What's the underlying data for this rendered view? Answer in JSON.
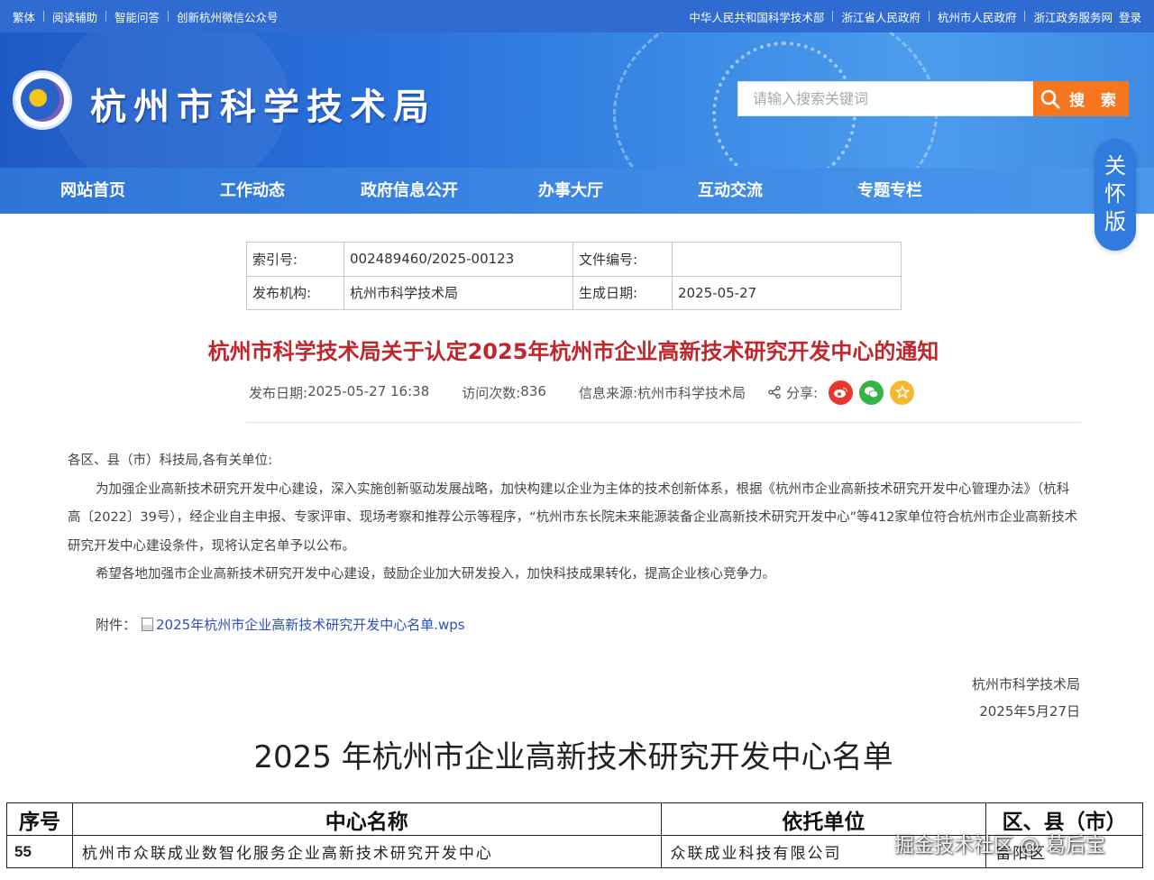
{
  "topbar": {
    "left": [
      "繁体",
      "阅读辅助",
      "智能问答",
      "创新杭州微信公众号"
    ],
    "right": [
      "中华人民共和国科学技术部",
      "浙江省人民政府",
      "杭州市人民政府",
      "浙江政务服务网"
    ],
    "login": "登录"
  },
  "header": {
    "site_title": "杭州市科学技术局",
    "search_placeholder": "请输入搜索关键词",
    "search_button": "搜 索"
  },
  "nav": [
    "网站首页",
    "工作动态",
    "政府信息公开",
    "办事大厅",
    "互动交流",
    "专题专栏"
  ],
  "elder_mode": [
    "关",
    "怀",
    "版"
  ],
  "meta": {
    "index_label": "索引号:",
    "index_value": "002489460/2025-00123",
    "docno_label": "文件编号:",
    "docno_value": "",
    "org_label": "发布机构:",
    "org_value": "杭州市科学技术局",
    "date_label": "生成日期:",
    "date_value": "2025-05-27"
  },
  "article": {
    "title": "杭州市科学技术局关于认定2025年杭州市企业高新技术研究开发中心的通知",
    "publish_label": "发布日期:",
    "publish_value": "2025-05-27 16:38",
    "visits_label": "访问次数:",
    "visits_value": "836",
    "source_label": "信息来源:",
    "source_value": "杭州市科学技术局",
    "share_label": "分享:",
    "salutation": "各区、县（市）科技局,各有关单位:",
    "para1": "为加强企业高新技术研究开发中心建设，深入实施创新驱动发展战略，加快构建以企业为主体的技术创新体系，根据《杭州市企业高新技术研究开发中心管理办法》（杭科高〔2022〕39号），经企业自主申报、专家评审、现场考察和推荐公示等程序，“杭州市东长院未来能源装备企业高新技术研究开发中心”等412家单位符合杭州市企业高新技术研究开发中心建设条件，现将认定名单予以公布。",
    "para2": "希望各地加强市企业高新技术研究开发中心建设，鼓励企业加大研发投入，加快科技成果转化，提高企业核心竞争力。",
    "attach_label": "附件：",
    "attach_name": "2025年杭州市企业高新技术研究开发中心名单.wps",
    "sign_org": "杭州市科学技术局",
    "sign_date": "2025年5月27日"
  },
  "list": {
    "title": "2025 年杭州市企业高新技术研究开发中心名单",
    "headers": [
      "序号",
      "中心名称",
      "依托单位",
      "区、县（市）"
    ],
    "rows": [
      [
        "55",
        "杭州市众联成业数智化服务企业高新技术研究开发中心",
        "众联成业科技有限公司",
        "富阳区"
      ]
    ]
  },
  "watermark": "掘金技术社区 @ 葛后宝"
}
